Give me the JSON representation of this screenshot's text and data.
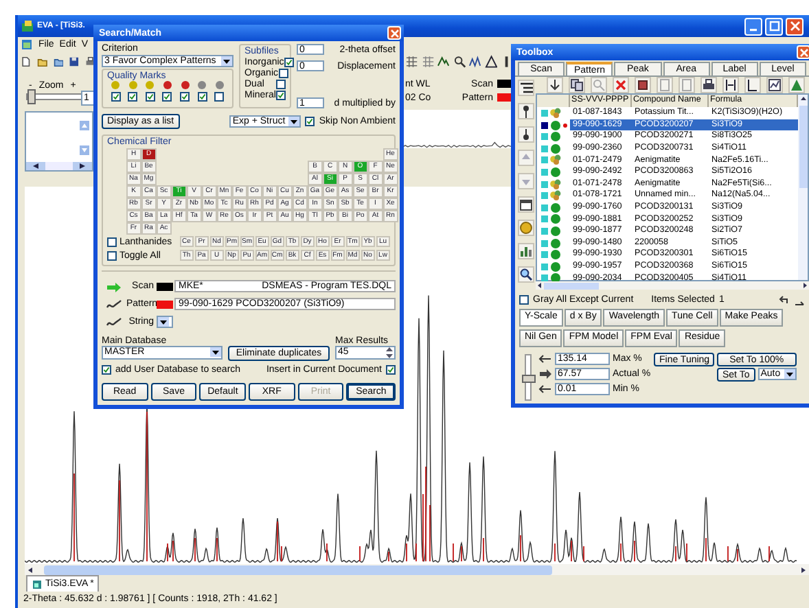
{
  "main_window": {
    "title": "EVA - [TiSi3.",
    "menu": [
      "File",
      "Edit",
      "V"
    ],
    "zoom": {
      "label": "Zoom",
      "minus": "-",
      "plus": "+",
      "level": 0,
      "value": "1"
    },
    "legend": [
      {
        "prefix": "nt WL",
        "label": "Scan",
        "color": "#000000"
      },
      {
        "prefix": "02 Co",
        "label": "Pattern",
        "color": "#ee1111"
      }
    ],
    "document_tabs": [
      {
        "label": "TiSi3.EVA *",
        "selected": true
      }
    ],
    "status_bar": "2-Theta : 45.632   d : 1.98761 ] [ Counts : 1918, 2Th : 41.62 ]"
  },
  "search_match": {
    "title": "Search/Match",
    "criterion": {
      "label": "Criterion",
      "value": "3 Favor Complex Patterns"
    },
    "quality_marks": {
      "label": "Quality Marks",
      "marks": [
        {
          "color": "#c8b400",
          "checked": true
        },
        {
          "color": "#c8b400",
          "checked": true
        },
        {
          "color": "#c8b400",
          "checked": true
        },
        {
          "color": "#cc2222",
          "checked": true
        },
        {
          "color": "#cc2222",
          "checked": true
        },
        {
          "color": "#888888",
          "checked": true
        },
        {
          "color": "#888888",
          "checked": false
        }
      ]
    },
    "subfiles": {
      "label": "Subfiles",
      "items": [
        {
          "label": "Inorganic",
          "checked": true
        },
        {
          "label": "Organic",
          "checked": false
        },
        {
          "label": "Dual",
          "checked": false
        },
        {
          "label": "Mineral",
          "checked": true
        }
      ]
    },
    "offsets": [
      {
        "value": "0",
        "label": "2-theta offset"
      },
      {
        "value": "0",
        "label": "Displacement"
      },
      {
        "value": "1",
        "label": "d multiplied by"
      }
    ],
    "display_button": "Display as a list",
    "filter_mode": "Exp + Struct",
    "skip_non_ambient": {
      "label": "Skip Non Ambient",
      "checked": true
    },
    "chemical_filter": {
      "label": "Chemical Filter",
      "rows": [
        {
          "left": [
            {
              "symbol": "H",
              "included": false,
              "excluded": false
            },
            {
              "symbol": "D",
              "included": false,
              "excluded": true
            }
          ],
          "right": [
            {
              "symbol": "He",
              "included": false,
              "excluded": false
            }
          ]
        },
        {
          "left": [
            {
              "symbol": "Li",
              "included": false,
              "excluded": false
            },
            {
              "symbol": "Be",
              "included": false,
              "excluded": false
            }
          ],
          "right": [
            {
              "symbol": "B",
              "included": false,
              "excluded": false
            },
            {
              "symbol": "C",
              "included": false,
              "excluded": false
            },
            {
              "symbol": "N",
              "included": false,
              "excluded": false
            },
            {
              "symbol": "O",
              "included": true,
              "excluded": false
            },
            {
              "symbol": "F",
              "included": false,
              "excluded": false
            },
            {
              "symbol": "Ne",
              "included": false,
              "excluded": false
            }
          ]
        },
        {
          "left": [
            {
              "symbol": "Na",
              "included": false,
              "excluded": false
            },
            {
              "symbol": "Mg",
              "included": false,
              "excluded": false
            }
          ],
          "right": [
            {
              "symbol": "Al",
              "included": false,
              "excluded": false
            },
            {
              "symbol": "Si",
              "included": true,
              "excluded": false
            },
            {
              "symbol": "P",
              "included": false,
              "excluded": false
            },
            {
              "symbol": "S",
              "included": false,
              "excluded": false
            },
            {
              "symbol": "Cl",
              "included": false,
              "excluded": false
            },
            {
              "symbol": "Ar",
              "included": false,
              "excluded": false
            }
          ]
        },
        {
          "left": [
            {
              "symbol": "K",
              "included": false,
              "excluded": false
            },
            {
              "symbol": "Ca",
              "included": false,
              "excluded": false
            },
            {
              "symbol": "Sc",
              "included": false,
              "excluded": false
            },
            {
              "symbol": "Ti",
              "included": true,
              "excluded": false
            },
            {
              "symbol": "V",
              "included": false,
              "excluded": false
            },
            {
              "symbol": "Cr",
              "included": false,
              "excluded": false
            },
            {
              "symbol": "Mn",
              "included": false,
              "excluded": false
            },
            {
              "symbol": "Fe",
              "included": false,
              "excluded": false
            },
            {
              "symbol": "Co",
              "included": false,
              "excluded": false
            },
            {
              "symbol": "Ni",
              "included": false,
              "excluded": false
            },
            {
              "symbol": "Cu",
              "included": false,
              "excluded": false
            },
            {
              "symbol": "Zn",
              "included": false,
              "excluded": false
            },
            {
              "symbol": "Ga",
              "included": false,
              "excluded": false
            },
            {
              "symbol": "Ge",
              "included": false,
              "excluded": false
            },
            {
              "symbol": "As",
              "included": false,
              "excluded": false
            },
            {
              "symbol": "Se",
              "included": false,
              "excluded": false
            },
            {
              "symbol": "Br",
              "included": false,
              "excluded": false
            },
            {
              "symbol": "Kr",
              "included": false,
              "excluded": false
            }
          ],
          "right": []
        },
        {
          "left": [
            {
              "symbol": "Rb",
              "included": false,
              "excluded": false
            },
            {
              "symbol": "Sr",
              "included": false,
              "excluded": false
            },
            {
              "symbol": "Y",
              "included": false,
              "excluded": false
            },
            {
              "symbol": "Zr",
              "included": false,
              "excluded": false
            },
            {
              "symbol": "Nb",
              "included": false,
              "excluded": false
            },
            {
              "symbol": "Mo",
              "included": false,
              "excluded": false
            },
            {
              "symbol": "Tc",
              "included": false,
              "excluded": false
            },
            {
              "symbol": "Ru",
              "included": false,
              "excluded": false
            },
            {
              "symbol": "Rh",
              "included": false,
              "excluded": false
            },
            {
              "symbol": "Pd",
              "included": false,
              "excluded": false
            },
            {
              "symbol": "Ag",
              "included": false,
              "excluded": false
            },
            {
              "symbol": "Cd",
              "included": false,
              "excluded": false
            },
            {
              "symbol": "In",
              "included": false,
              "excluded": false
            },
            {
              "symbol": "Sn",
              "included": false,
              "excluded": false
            },
            {
              "symbol": "Sb",
              "included": false,
              "excluded": false
            },
            {
              "symbol": "Te",
              "included": false,
              "excluded": false
            },
            {
              "symbol": "I",
              "included": false,
              "excluded": false
            },
            {
              "symbol": "Xe",
              "included": false,
              "excluded": false
            }
          ],
          "right": []
        },
        {
          "left": [
            {
              "symbol": "Cs",
              "included": false,
              "excluded": false
            },
            {
              "symbol": "Ba",
              "included": false,
              "excluded": false
            },
            {
              "symbol": "La",
              "included": false,
              "excluded": false
            },
            {
              "symbol": "Hf",
              "included": false,
              "excluded": false
            },
            {
              "symbol": "Ta",
              "included": false,
              "excluded": false
            },
            {
              "symbol": "W",
              "included": false,
              "excluded": false
            },
            {
              "symbol": "Re",
              "included": false,
              "excluded": false
            },
            {
              "symbol": "Os",
              "included": false,
              "excluded": false
            },
            {
              "symbol": "Ir",
              "included": false,
              "excluded": false
            },
            {
              "symbol": "Pt",
              "included": false,
              "excluded": false
            },
            {
              "symbol": "Au",
              "included": false,
              "excluded": false
            },
            {
              "symbol": "Hg",
              "included": false,
              "excluded": false
            },
            {
              "symbol": "Tl",
              "included": false,
              "excluded": false
            },
            {
              "symbol": "Pb",
              "included": false,
              "excluded": false
            },
            {
              "symbol": "Bi",
              "included": false,
              "excluded": false
            },
            {
              "symbol": "Po",
              "included": false,
              "excluded": false
            },
            {
              "symbol": "At",
              "included": false,
              "excluded": false
            },
            {
              "symbol": "Rn",
              "included": false,
              "excluded": false
            }
          ],
          "right": []
        },
        {
          "left": [
            {
              "symbol": "Fr",
              "included": false,
              "excluded": false
            },
            {
              "symbol": "Ra",
              "included": false,
              "excluded": false
            },
            {
              "symbol": "Ac",
              "included": false,
              "excluded": false
            }
          ],
          "right": []
        }
      ],
      "series": [
        {
          "label": "Lanthanides",
          "checked": false,
          "elements": [
            {
              "symbol": "Ce",
              "included": false,
              "excluded": false
            },
            {
              "symbol": "Pr",
              "included": false,
              "excluded": false
            },
            {
              "symbol": "Nd",
              "included": false,
              "excluded": false
            },
            {
              "symbol": "Pm",
              "included": false,
              "excluded": false
            },
            {
              "symbol": "Sm",
              "included": false,
              "excluded": false
            },
            {
              "symbol": "Eu",
              "included": false,
              "excluded": false
            },
            {
              "symbol": "Gd",
              "included": false,
              "excluded": false
            },
            {
              "symbol": "Tb",
              "included": false,
              "excluded": false
            },
            {
              "symbol": "Dy",
              "included": false,
              "excluded": false
            },
            {
              "symbol": "Ho",
              "included": false,
              "excluded": false
            },
            {
              "symbol": "Er",
              "included": false,
              "excluded": false
            },
            {
              "symbol": "Tm",
              "included": false,
              "excluded": false
            },
            {
              "symbol": "Yb",
              "included": false,
              "excluded": false
            },
            {
              "symbol": "Lu",
              "included": false,
              "excluded": false
            }
          ]
        },
        {
          "label": "Toggle All",
          "checked": false,
          "elements": [
            {
              "symbol": "Th",
              "included": false,
              "excluded": false
            },
            {
              "symbol": "Pa",
              "included": false,
              "excluded": false
            },
            {
              "symbol": "U",
              "included": false,
              "excluded": false
            },
            {
              "symbol": "Np",
              "included": false,
              "excluded": false
            },
            {
              "symbol": "Pu",
              "included": false,
              "excluded": false
            },
            {
              "symbol": "Am",
              "included": false,
              "excluded": false
            },
            {
              "symbol": "Cm",
              "included": false,
              "excluded": false
            },
            {
              "symbol": "Bk",
              "included": false,
              "excluded": false
            },
            {
              "symbol": "Cf",
              "included": false,
              "excluded": false
            },
            {
              "symbol": "Es",
              "included": false,
              "excluded": false
            },
            {
              "symbol": "Fm",
              "included": false,
              "excluded": false
            },
            {
              "symbol": "Md",
              "included": false,
              "excluded": false
            },
            {
              "symbol": "No",
              "included": false,
              "excluded": false
            },
            {
              "symbol": "Lw",
              "included": false,
              "excluded": false
            }
          ]
        }
      ]
    },
    "sources": [
      {
        "kind": "scan",
        "label": "Scan",
        "color": "#000000",
        "value": "MKE*",
        "program": "DSMEAS - Program TES.DQL"
      },
      {
        "kind": "pattern",
        "label": "Pattern",
        "color": "#ee1111",
        "value": "99-090-1629 PCOD3200207 (Si3TiO9)"
      },
      {
        "kind": "string",
        "label": "String"
      }
    ],
    "main_database": {
      "label": "Main Database",
      "value": "MASTER"
    },
    "eliminate_button": "Eliminate duplicates",
    "max_results": {
      "label": "Max Results",
      "value": "45"
    },
    "add_user_database": {
      "label": "add User Database to search",
      "checked": true
    },
    "insert_current": {
      "label": "Insert in Current Document",
      "checked": true
    },
    "buttons": [
      {
        "label": "Read",
        "disabled": false,
        "default": false
      },
      {
        "label": "Save",
        "disabled": false,
        "default": false
      },
      {
        "label": "Default",
        "disabled": false,
        "default": false
      },
      {
        "label": "XRF",
        "disabled": false,
        "default": false
      },
      {
        "label": "Print",
        "disabled": true,
        "default": false
      },
      {
        "label": "Search",
        "disabled": false,
        "default": true
      }
    ]
  },
  "toolbox": {
    "title": "Toolbox",
    "tabs": [
      {
        "label": "Scan",
        "selected": false
      },
      {
        "label": "Pattern",
        "selected": true
      },
      {
        "label": "Peak",
        "selected": false
      },
      {
        "label": "Area",
        "selected": false
      },
      {
        "label": "Label",
        "selected": false
      },
      {
        "label": "Level",
        "selected": false
      }
    ],
    "columns": [
      "SS-VVV-PPPP",
      "Compound Name",
      "Formula"
    ],
    "rows": [
      {
        "color": "#33cccc",
        "kind": "multi",
        "selected": false,
        "marked": false,
        "number": "01-087-1843",
        "name": "Potassium Tit...",
        "formula": "K2(TiSi3O9)(H2O)"
      },
      {
        "color": "#000080",
        "kind": "dot",
        "selected": true,
        "marked": true,
        "number": "99-090-1629",
        "name": "PCOD3200207",
        "formula": "Si3TiO9"
      },
      {
        "color": "#33cccc",
        "kind": "dot",
        "selected": false,
        "marked": false,
        "number": "99-090-1900",
        "name": "PCOD3200271",
        "formula": "Si8Ti3O25"
      },
      {
        "color": "#33cccc",
        "kind": "dot",
        "selected": false,
        "marked": false,
        "number": "99-090-2360",
        "name": "PCOD3200731",
        "formula": "Si4TiO11"
      },
      {
        "color": "#33cccc",
        "kind": "multi",
        "selected": false,
        "marked": false,
        "number": "01-071-2479",
        "name": "Aenigmatite",
        "formula": "Na2Fe5.16Ti..."
      },
      {
        "color": "#33cccc",
        "kind": "dot",
        "selected": false,
        "marked": false,
        "number": "99-090-2492",
        "name": "PCOD3200863",
        "formula": "Si5Ti2O16"
      },
      {
        "color": "#33cccc",
        "kind": "multi",
        "selected": false,
        "marked": false,
        "number": "01-071-2478",
        "name": "Aenigmatite",
        "formula": "Na2Fe5Ti(Si6..."
      },
      {
        "color": "#33cccc",
        "kind": "multi",
        "selected": false,
        "marked": false,
        "number": "01-078-1721",
        "name": "Unnamed min...",
        "formula": "Na12(Na5.04..."
      },
      {
        "color": "#33cccc",
        "kind": "dot",
        "selected": false,
        "marked": false,
        "number": "99-090-1760",
        "name": "PCOD3200131",
        "formula": "Si3TiO9"
      },
      {
        "color": "#33cccc",
        "kind": "dot",
        "selected": false,
        "marked": false,
        "number": "99-090-1881",
        "name": "PCOD3200252",
        "formula": "Si3TiO9"
      },
      {
        "color": "#33cccc",
        "kind": "dot",
        "selected": false,
        "marked": false,
        "number": "99-090-1877",
        "name": "PCOD3200248",
        "formula": "Si2TiO7"
      },
      {
        "color": "#33cccc",
        "kind": "dot",
        "selected": false,
        "marked": false,
        "number": "99-090-1480",
        "name": "2200058",
        "formula": "SiTiO5"
      },
      {
        "color": "#33cccc",
        "kind": "dot",
        "selected": false,
        "marked": false,
        "number": "99-090-1930",
        "name": "PCOD3200301",
        "formula": "Si6TiO15"
      },
      {
        "color": "#33cccc",
        "kind": "dot",
        "selected": false,
        "marked": false,
        "number": "99-090-1957",
        "name": "PCOD3200368",
        "formula": "Si6TiO15"
      },
      {
        "color": "#33cccc",
        "kind": "dot",
        "selected": false,
        "marked": false,
        "number": "99-090-2034",
        "name": "PCOD3200405",
        "formula": "Si4TiO11"
      }
    ],
    "gray_all": {
      "label": "Gray All Except Current",
      "checked": false
    },
    "items_selected": {
      "label": "Items Selected",
      "value": "1"
    },
    "tool_tabs": [
      [
        {
          "label": "Y-Scale",
          "selected": true
        },
        {
          "label": "d x By",
          "selected": false
        },
        {
          "label": "Wavelength",
          "selected": false
        },
        {
          "label": "Tune Cell",
          "selected": false
        },
        {
          "label": "Make Peaks",
          "selected": false
        }
      ],
      [
        {
          "label": "Nil Gen",
          "selected": false
        },
        {
          "label": "FPM Model",
          "selected": false
        },
        {
          "label": "FPM Eval",
          "selected": false
        },
        {
          "label": "Residue",
          "selected": false
        }
      ]
    ],
    "scale": {
      "level": 0.5,
      "fields": [
        {
          "value": "135.14",
          "label": "Max %"
        },
        {
          "value": "67.57",
          "label": "Actual %"
        },
        {
          "value": "0.01",
          "label": "Min %"
        }
      ],
      "fine_tuning": "Fine Tuning",
      "set_100": "Set To 100%",
      "set_to": "Set To",
      "mode": "Auto"
    }
  }
}
